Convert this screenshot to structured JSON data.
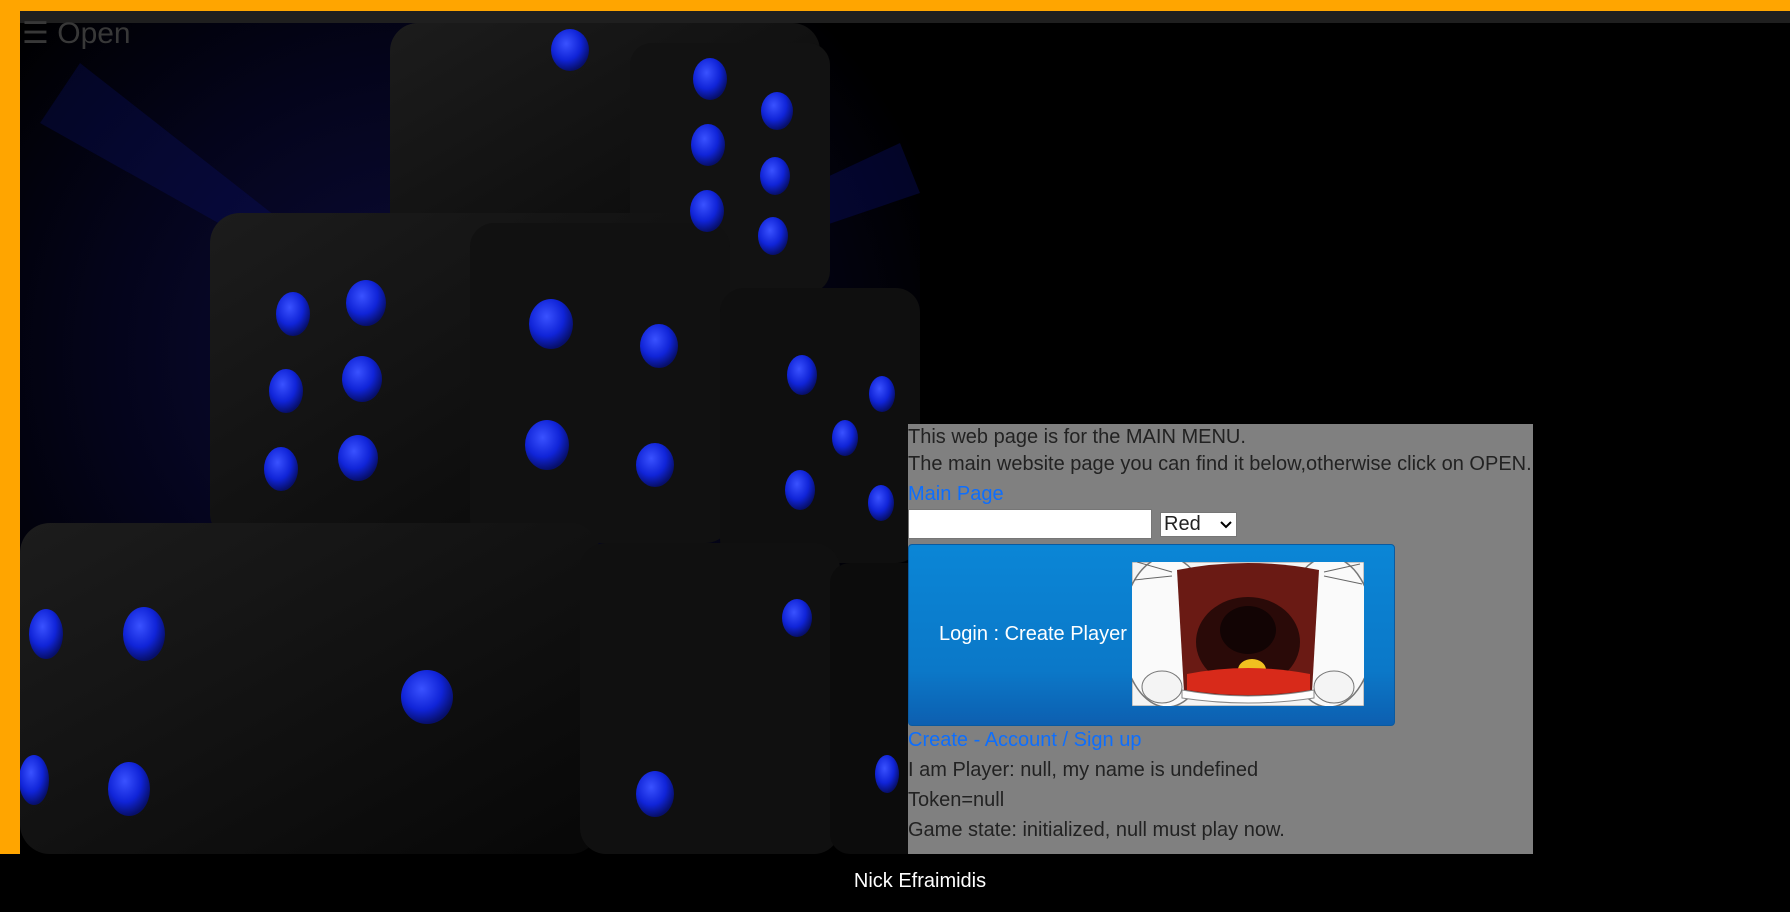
{
  "colors": {
    "frame_accent": "#ffa500",
    "panel_background": "#808080",
    "link": "#0d6efd",
    "login_button": "#0b78c8",
    "dice_background": "#000000",
    "dice_pips": "#1024d8",
    "footer_background": "#000000",
    "footer_text": "#ffffff"
  },
  "nav": {
    "open_label": "☰ Open",
    "open_icon": "hamburger-menu-icon"
  },
  "info": {
    "line1": "This web page is for the MAIN MENU.",
    "line2": "The main website page you can find it below,otherwise click on OPEN.",
    "main_page_link": "Main Page"
  },
  "form": {
    "name_value": "",
    "color_selected": "Red"
  },
  "login": {
    "button_label": "Login : Create Player"
  },
  "signup": {
    "link_label": "Create - Account / Sign up"
  },
  "status": {
    "player_line": "I am Player: null, my name is undefined",
    "token_line": "Token=null",
    "game_state_line": "Game state: initialized, null must play now."
  },
  "footer": {
    "author": "Nick Efraimidis"
  }
}
